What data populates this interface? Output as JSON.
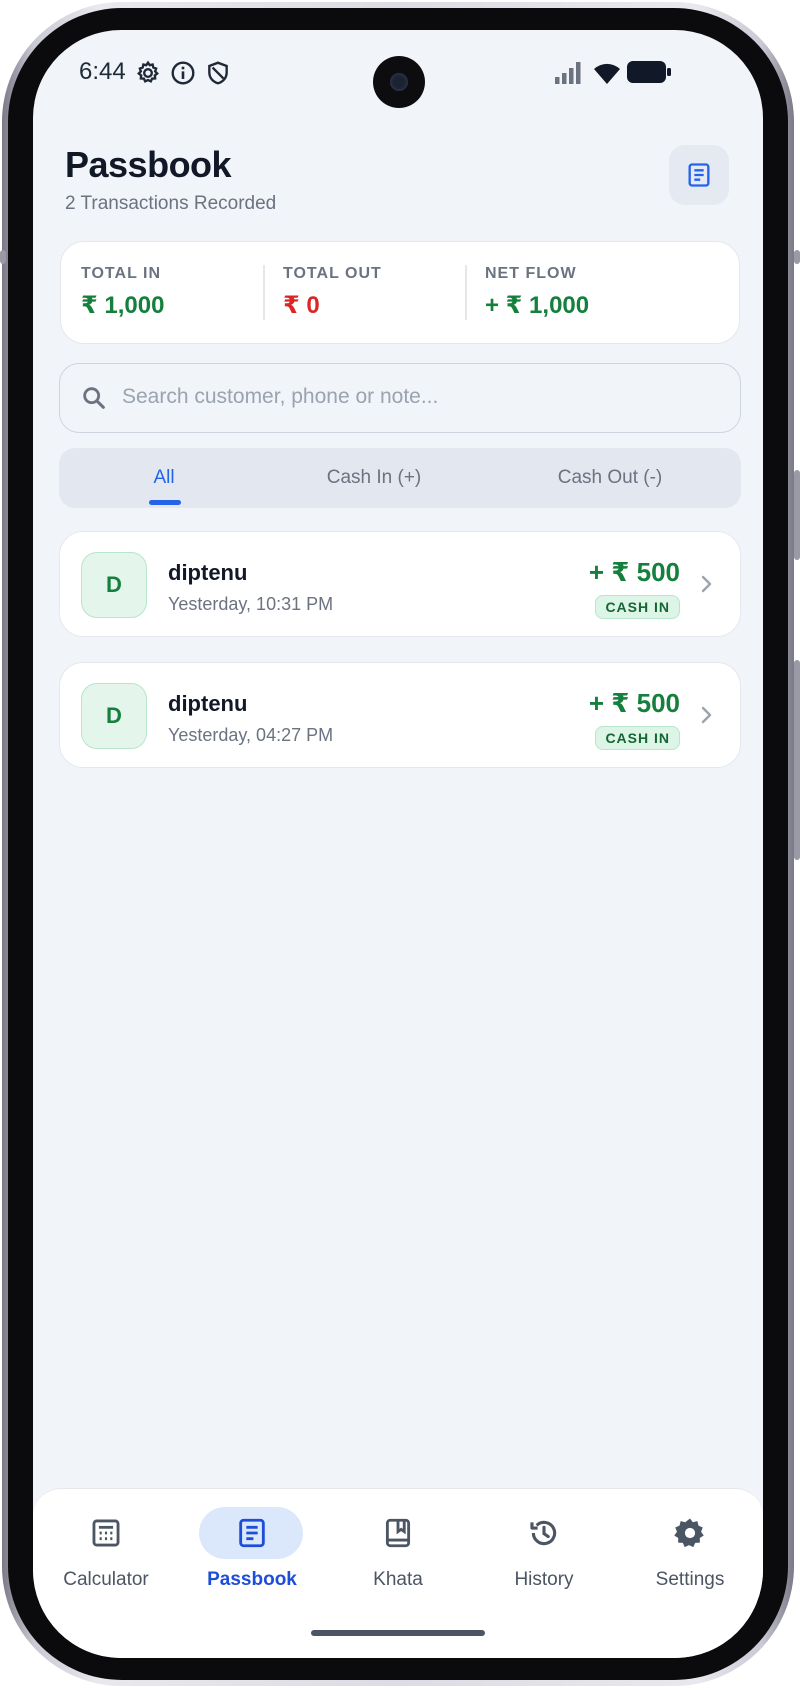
{
  "status_bar": {
    "time": "6:44"
  },
  "header": {
    "title": "Passbook",
    "subtitle": "2 Transactions Recorded"
  },
  "summary": {
    "total_in_label": "TOTAL IN",
    "total_in_value": "₹ 1,000",
    "total_out_label": "TOTAL OUT",
    "total_out_value": "₹ 0",
    "net_flow_label": "NET FLOW",
    "net_flow_value": "+ ₹ 1,000"
  },
  "search": {
    "placeholder": "Search customer, phone or note..."
  },
  "tabs": [
    {
      "label": "All",
      "active": true
    },
    {
      "label": "Cash In (+)",
      "active": false
    },
    {
      "label": "Cash Out (-)",
      "active": false
    }
  ],
  "transactions": [
    {
      "initial": "D",
      "name": "diptenu",
      "date": "Yesterday, 10:31 PM",
      "amount": "+ ₹ 500",
      "badge": "CASH IN"
    },
    {
      "initial": "D",
      "name": "diptenu",
      "date": "Yesterday, 04:27 PM",
      "amount": "+ ₹ 500",
      "badge": "CASH IN"
    }
  ],
  "bottom_nav": [
    {
      "label": "Calculator",
      "icon": "calculator-icon",
      "active": false
    },
    {
      "label": "Passbook",
      "icon": "passbook-icon",
      "active": true
    },
    {
      "label": "Khata",
      "icon": "book-icon",
      "active": false
    },
    {
      "label": "History",
      "icon": "history-icon",
      "active": false
    },
    {
      "label": "Settings",
      "icon": "gear-icon",
      "active": false
    }
  ],
  "colors": {
    "accent": "#2563eb",
    "positive": "#15803d",
    "negative": "#dc2626",
    "background": "#f1f4f8"
  }
}
